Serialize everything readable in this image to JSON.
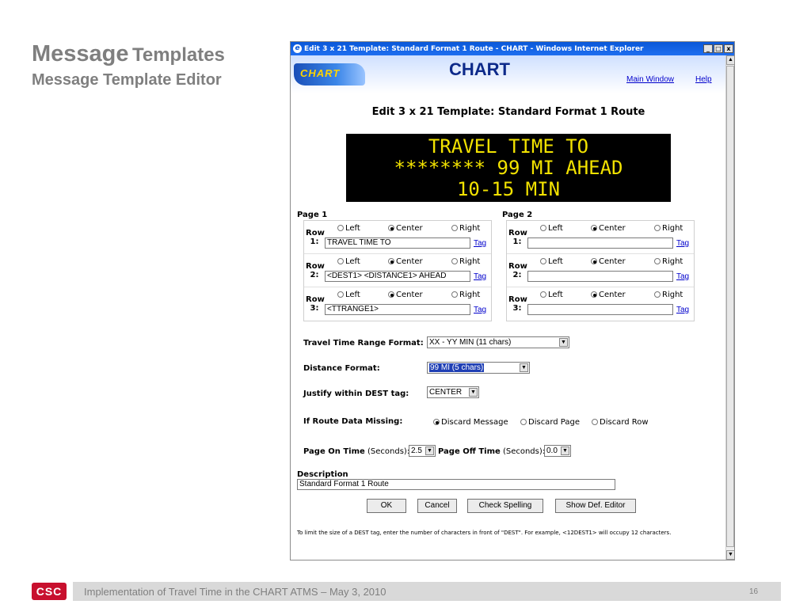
{
  "slide": {
    "title_big": "Message",
    "title_rest": "Templates",
    "subtitle": "Message Template Editor",
    "footer_text": "Implementation of Travel Time in the CHART ATMS – May 3, 2010",
    "page_number": "16",
    "logo_text": "CSC"
  },
  "window": {
    "title": "Edit 3 x 21 Template: Standard Format 1 Route - CHART - Windows Internet Explorer",
    "controls": {
      "minimize": "_",
      "maximize": "□",
      "close": "x"
    }
  },
  "banner": {
    "logo_text": "CHART",
    "title": "CHART",
    "main_window_link": "Main Window",
    "help_link": "Help"
  },
  "editor": {
    "heading": "Edit 3 x 21 Template: Standard Format 1 Route",
    "sign_lines": [
      "TRAVEL TIME TO",
      "******** 99 MI AHEAD",
      "10-15 MIN"
    ],
    "page1_label": "Page 1",
    "page2_label": "Page 2",
    "radio_labels": {
      "left": "Left",
      "center": "Center",
      "right": "Right"
    },
    "tag_label": "Tag",
    "page1_rows": [
      {
        "label_top": "Row",
        "label_bottom": "1:",
        "value": "TRAVEL TIME TO",
        "selected": "center"
      },
      {
        "label_top": "Row",
        "label_bottom": "2:",
        "value": "<DEST1> <DISTANCE1> AHEAD",
        "selected": "center"
      },
      {
        "label_top": "Row",
        "label_bottom": "3:",
        "value": "<TTRANGE1>",
        "selected": "center"
      }
    ],
    "page2_rows": [
      {
        "label_top": "Row",
        "label_bottom": "1:",
        "value": "",
        "selected": "center"
      },
      {
        "label_top": "Row",
        "label_bottom": "2:",
        "value": "",
        "selected": "center"
      },
      {
        "label_top": "Row",
        "label_bottom": "3:",
        "value": "",
        "selected": "center"
      }
    ],
    "travel_time_range_label": "Travel Time Range Format:",
    "travel_time_range_value": "XX - YY MIN (11 chars)",
    "distance_format_label": "Distance Format:",
    "distance_format_value": "99 MI (5 chars)",
    "justify_label": "Justify within DEST tag:",
    "justify_value": "CENTER",
    "route_missing_label": "If Route Data Missing:",
    "route_missing_options": [
      "Discard Message",
      "Discard Page",
      "Discard Row"
    ],
    "route_missing_selected": "Discard Message",
    "page_on_label": "Page On Time",
    "page_on_units": "(Seconds):",
    "page_on_value": "2.5",
    "page_off_label": "Page Off Time",
    "page_off_units": "(Seconds):",
    "page_off_value": "0.0",
    "description_label": "Description",
    "description_value": "Standard Format 1 Route",
    "buttons": {
      "ok": "OK",
      "cancel": "Cancel",
      "check_spelling": "Check Spelling",
      "show_def_editor": "Show Def. Editor"
    },
    "footnote": "To limit the size of a DEST tag, enter the number of characters in front of \"DEST\". For example, <12DEST1> will occupy 12 characters."
  },
  "colors": {
    "sign_text": "#f2e200",
    "link": "#0000cc",
    "brand_red": "#c8102e",
    "title_gray": "#7f7f7f"
  }
}
